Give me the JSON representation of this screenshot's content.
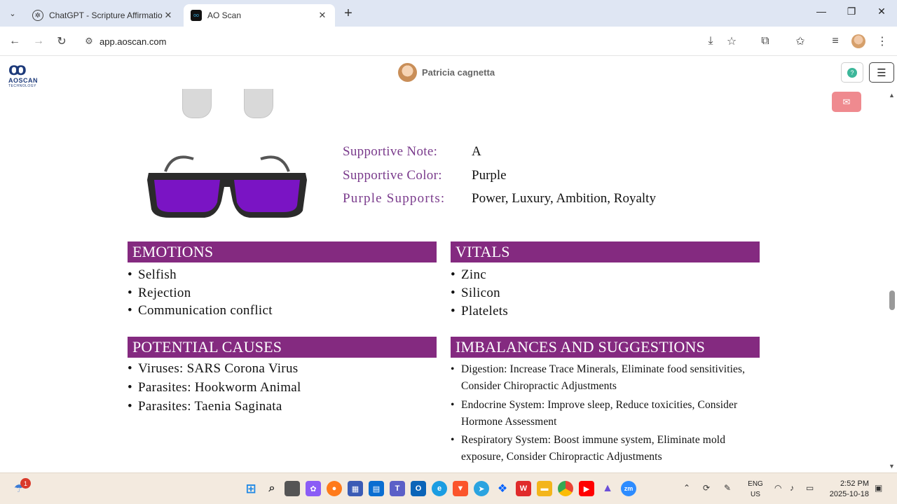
{
  "browser": {
    "tabs": [
      {
        "title": "ChatGPT - Scripture Affirmatio",
        "active": false
      },
      {
        "title": "AO Scan",
        "active": true
      }
    ],
    "url": "app.aoscan.com"
  },
  "header": {
    "logo_text": "AOSCAN",
    "logo_sub": "TECHNOLOGY",
    "user_name": "Patricia cagnetta"
  },
  "supportive": {
    "note_label": "Supportive Note:",
    "note_value": "A",
    "color_label": "Supportive Color:",
    "color_value": "Purple",
    "supports_label": "Purple Supports:",
    "supports_value": "Power, Luxury, Ambition, Royalty",
    "lens_color": "#7a14c4"
  },
  "sections": {
    "emotions": {
      "title": "EMOTIONS",
      "items": [
        "Selfish",
        "Rejection",
        "Communication conflict"
      ]
    },
    "vitals": {
      "title": "VITALS",
      "items": [
        "Zinc",
        "Silicon",
        "Platelets"
      ]
    },
    "causes": {
      "title": "POTENTIAL CAUSES",
      "items": [
        "Viruses: SARS Corona Virus",
        "Parasites: Hookworm Animal",
        "Parasites: Taenia Saginata"
      ]
    },
    "imbalances": {
      "title": "IMBALANCES AND SUGGESTIONS",
      "items": [
        "Digestion: Increase Trace Minerals, Eliminate food sensitivities, Consider Chiropractic Adjustments",
        "Endocrine System: Improve sleep, Reduce toxicities, Consider Hormone Assessment",
        "Respiratory System: Boost immune system, Eliminate mold exposure, Consider Chiropractic Adjustments"
      ]
    }
  },
  "colors": {
    "section_bg": "#842a80",
    "label_purple": "#7a3b8c"
  },
  "taskbar": {
    "notification_count": "1",
    "lang_line1": "ENG",
    "lang_line2": "US",
    "time": "2:52 PM",
    "date": "2025-10-18"
  }
}
